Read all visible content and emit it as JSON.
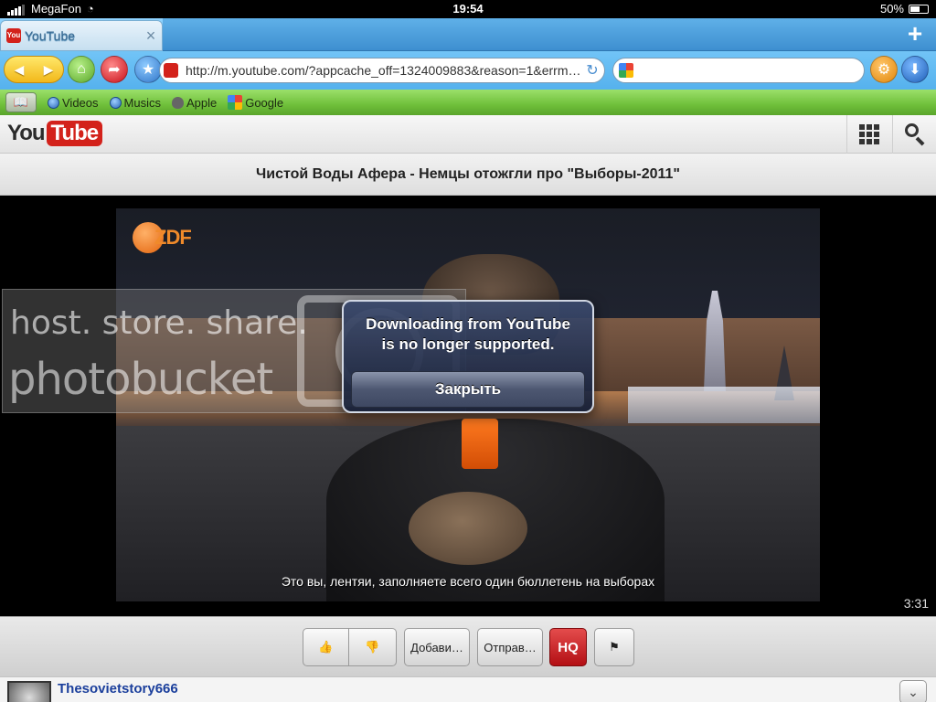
{
  "status_bar": {
    "carrier": "MegaFon",
    "time": "19:54",
    "battery": "50%"
  },
  "browser": {
    "tab": {
      "title": "YouTube",
      "close": "×"
    },
    "new_tab": "+",
    "url": "http://m.youtube.com/?appcache_off=1324009883&reason=1&errm…",
    "bookmarks": [
      "Videos",
      "Musics",
      "Apple",
      "Google"
    ]
  },
  "youtube": {
    "logo_you": "You",
    "logo_tube": "Tube",
    "video_title": "Чистой Воды Афера - Немцы отожгли про \"Выборы-2011\"",
    "zdf_label": "ZDF",
    "subtitle": "Это вы, лентяи, заполняете всего один бюллетень на выборах",
    "duration": "3:31",
    "actions": {
      "add": "Добави…",
      "send": "Отправ…",
      "hq": "HQ"
    },
    "uploader": {
      "name": "Thesovietstory666"
    }
  },
  "watermark": {
    "line1": "host. store. share.",
    "line2": "photobucket"
  },
  "alert": {
    "line1": "Downloading from YouTube",
    "line2": "is no longer supported.",
    "button": "Закрыть"
  },
  "colors": {
    "youtube_red": "#d3221b",
    "alert_bg": "#2a3550",
    "link_blue": "#1b3f9c"
  },
  "icons": [
    "wifi-icon",
    "back-icon",
    "forward-icon",
    "home-icon",
    "share-icon",
    "star-icon",
    "reload-icon",
    "google-icon",
    "gear-icon",
    "download-icon",
    "book-icon",
    "grid-icon",
    "search-icon",
    "thumb-up-icon",
    "thumb-down-icon",
    "flag-icon",
    "expand-icon"
  ]
}
